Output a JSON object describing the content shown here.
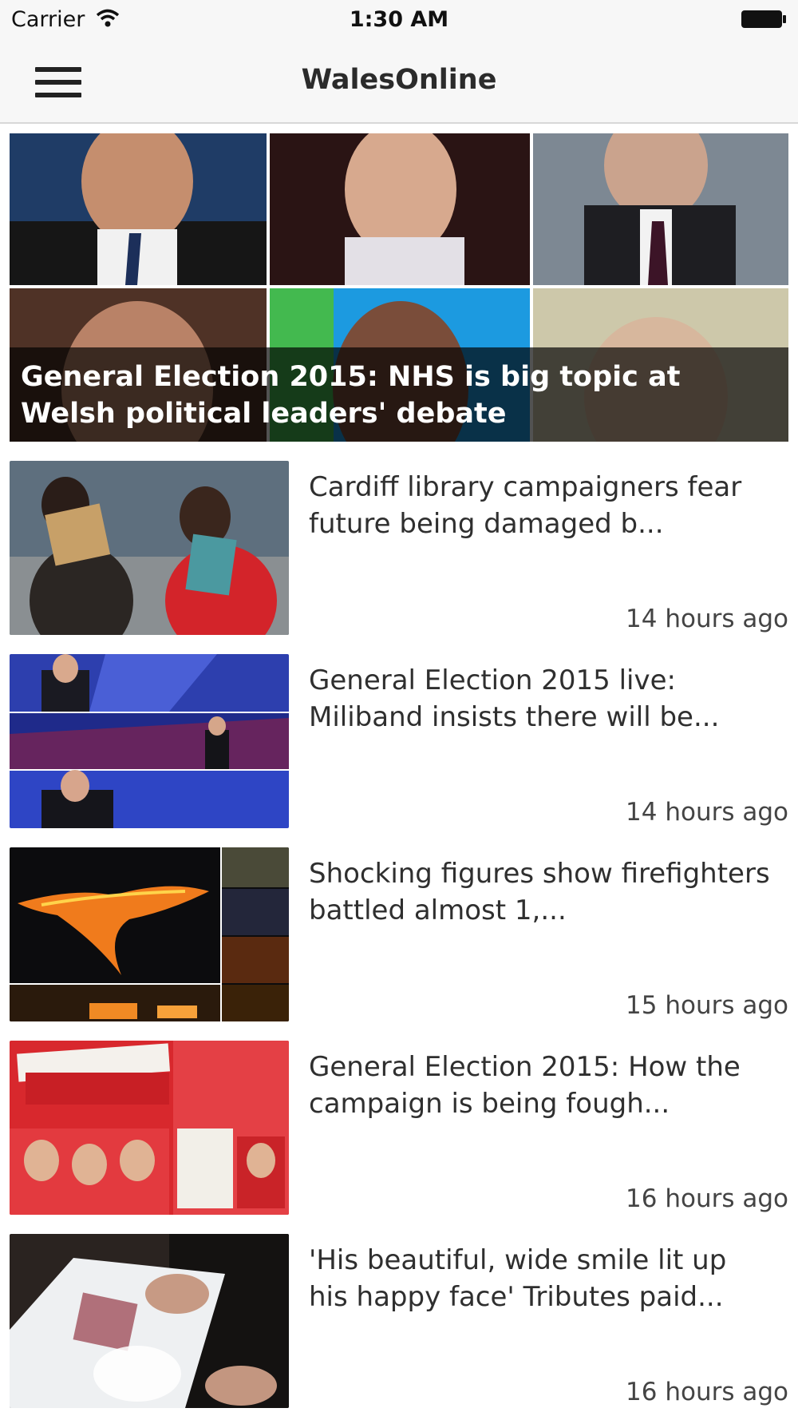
{
  "status_bar": {
    "carrier": "Carrier",
    "time": "1:30 AM"
  },
  "nav": {
    "title": "WalesOnline",
    "menu_icon": "hamburger-menu-icon"
  },
  "hero": {
    "title": "General Election 2015: NHS is big topic at Welsh political leaders' debate"
  },
  "articles": [
    {
      "title": "Cardiff library campaigners fear future being damaged b...",
      "time": "14 hours ago"
    },
    {
      "title": "General Election 2015 live: Miliband insists there will be...",
      "time": "14 hours ago"
    },
    {
      "title": "Shocking figures show firefighters battled almost 1,...",
      "time": "15 hours ago"
    },
    {
      "title": "General Election 2015: How the campaign is being fough...",
      "time": "16 hours ago"
    },
    {
      "title": "'His beautiful, wide smile lit up his happy face' Tributes paid...",
      "time": "16 hours ago"
    }
  ],
  "colors": {
    "bar_background": "#f7f7f7",
    "text": "#333333",
    "hero_caption_overlay": "#000000"
  }
}
